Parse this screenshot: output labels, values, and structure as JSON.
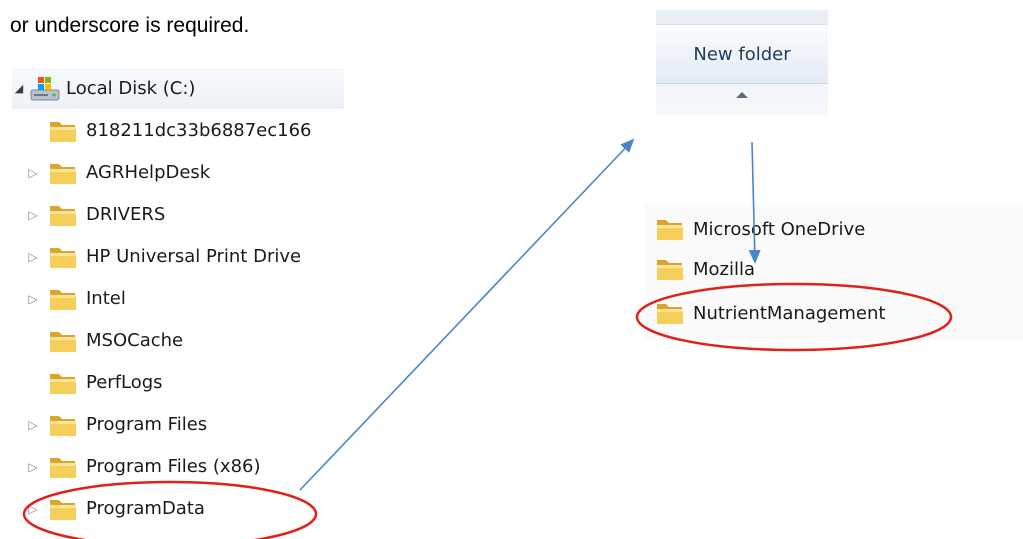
{
  "intro_text": "or underscore is required.",
  "tree": {
    "root": {
      "label": "Local Disk (C:)",
      "expanded": true
    },
    "items": [
      {
        "label": "818211dc33b6887ec166",
        "has_children": false
      },
      {
        "label": "AGRHelpDesk",
        "has_children": true
      },
      {
        "label": "DRIVERS",
        "has_children": true
      },
      {
        "label": "HP Universal Print Drive",
        "has_children": true
      },
      {
        "label": "Intel",
        "has_children": true
      },
      {
        "label": "MSOCache",
        "has_children": false
      },
      {
        "label": "PerfLogs",
        "has_children": false
      },
      {
        "label": "Program Files",
        "has_children": true
      },
      {
        "label": "Program Files (x86)",
        "has_children": true
      },
      {
        "label": "ProgramData",
        "has_children": true,
        "highlighted": true
      }
    ]
  },
  "toolbar": {
    "new_folder_label": "New folder"
  },
  "result_list": {
    "items": [
      {
        "label": "Microsoft OneDrive"
      },
      {
        "label": "Mozilla"
      },
      {
        "label": "NutrientManagement",
        "highlighted": true
      }
    ]
  },
  "colors": {
    "annotation_circle": "#e0201b",
    "annotation_arrow": "#4a86c6",
    "folder_yellow": "#f2c94c",
    "toolbar_text": "#1e395b"
  }
}
